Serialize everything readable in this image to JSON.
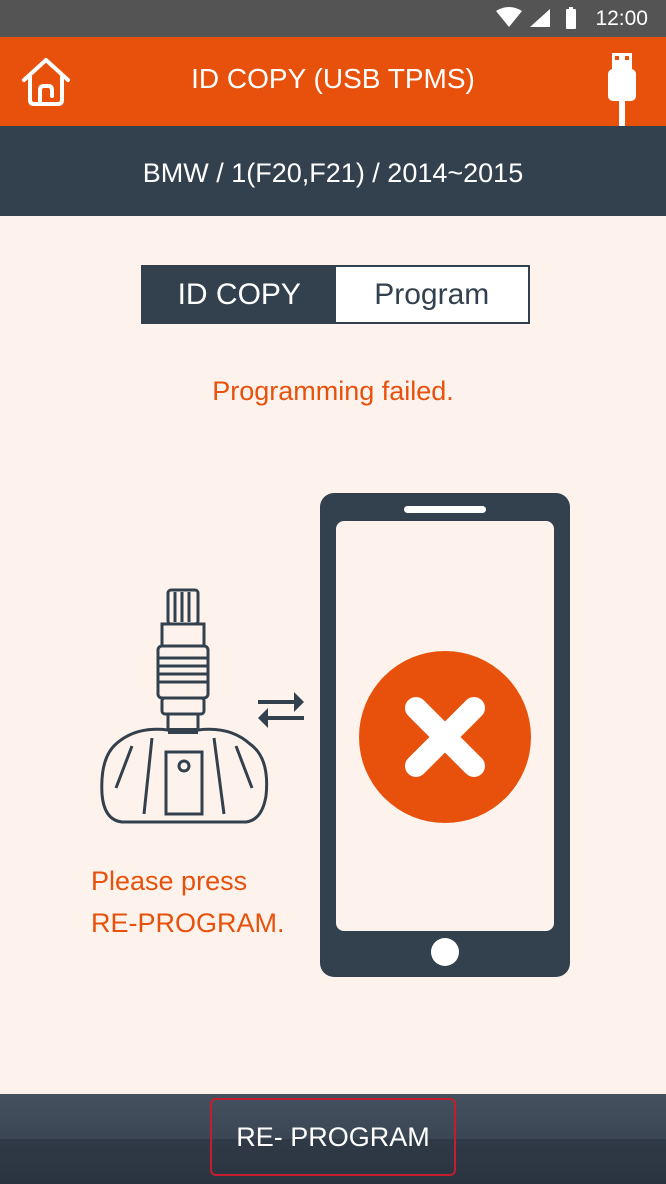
{
  "status_bar": {
    "time": "12:00"
  },
  "app_bar": {
    "title": "ID COPY (USB TPMS)"
  },
  "vehicle": {
    "path": "BMW / 1(F20,F21) / 2014~2015"
  },
  "mode_tabs": {
    "active": "ID COPY",
    "inactive": "Program"
  },
  "result": {
    "message": "Programming failed."
  },
  "instruction": {
    "line1": "Please press",
    "line2": "RE-PROGRAM."
  },
  "footer": {
    "button_label": "RE- PROGRAM"
  },
  "colors": {
    "accent": "#e8510c",
    "dark": "#33414f",
    "background": "#fdf3ec",
    "button_border": "#c41e2e"
  }
}
